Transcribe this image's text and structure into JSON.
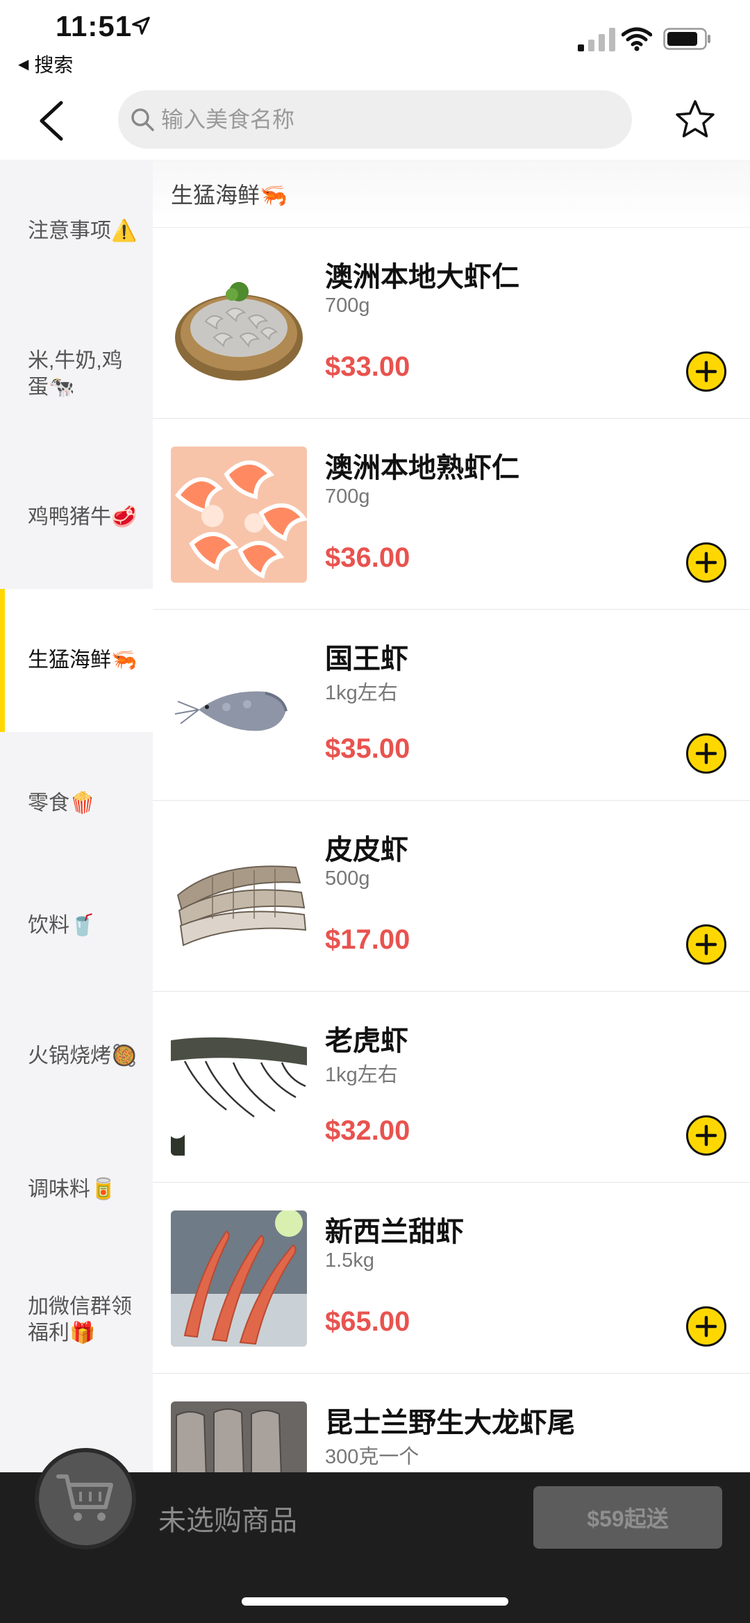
{
  "status_bar": {
    "time": "11:51",
    "back_app_label": "搜索"
  },
  "header": {
    "search_placeholder": "输入美食名称"
  },
  "sidebar": {
    "items": [
      {
        "label": "注意事项⚠️",
        "active": false
      },
      {
        "label": "米,牛奶,鸡蛋🐄",
        "active": false
      },
      {
        "label": "鸡鸭猪牛🥩",
        "active": false
      },
      {
        "label": "生猛海鲜🦐",
        "active": true
      },
      {
        "label": "零食🍿",
        "active": false
      },
      {
        "label": "饮料🥤",
        "active": false
      },
      {
        "label": "火锅烧烤🥘",
        "active": false
      },
      {
        "label": "调味料🥫",
        "active": false
      },
      {
        "label": "加微信群领福利🎁",
        "active": false
      }
    ]
  },
  "main": {
    "section_title": "生猛海鲜🦐",
    "products": [
      {
        "name": "澳洲本地大虾仁",
        "spec": "700g",
        "price": "$33.00",
        "image": "shrimp-meat-basket"
      },
      {
        "name": "澳洲本地熟虾仁",
        "spec": "700g",
        "price": "$36.00",
        "image": "cooked-shrimp"
      },
      {
        "name": "国王虾",
        "spec": "1kg左右",
        "price": "$35.00",
        "image": "king-prawn"
      },
      {
        "name": "皮皮虾",
        "spec": "500g",
        "price": "$17.00",
        "image": "mantis-shrimp"
      },
      {
        "name": "老虎虾",
        "spec": "1kg左右",
        "price": "$32.00",
        "image": "tiger-prawn"
      },
      {
        "name": "新西兰甜虾",
        "spec": "1.5kg",
        "price": "$65.00",
        "image": "nz-sweet-shrimp"
      },
      {
        "name": "昆士兰野生大龙虾尾",
        "spec": "300克一个",
        "price": "",
        "image": "lobster-tail"
      }
    ]
  },
  "cart": {
    "empty_text": "未选购商品",
    "checkout_label": "$59起送"
  },
  "colors": {
    "accent": "#ffd700",
    "price": "#e8534f",
    "cart_bg": "#1e1e1e",
    "sidebar_bg": "#f4f4f6"
  }
}
